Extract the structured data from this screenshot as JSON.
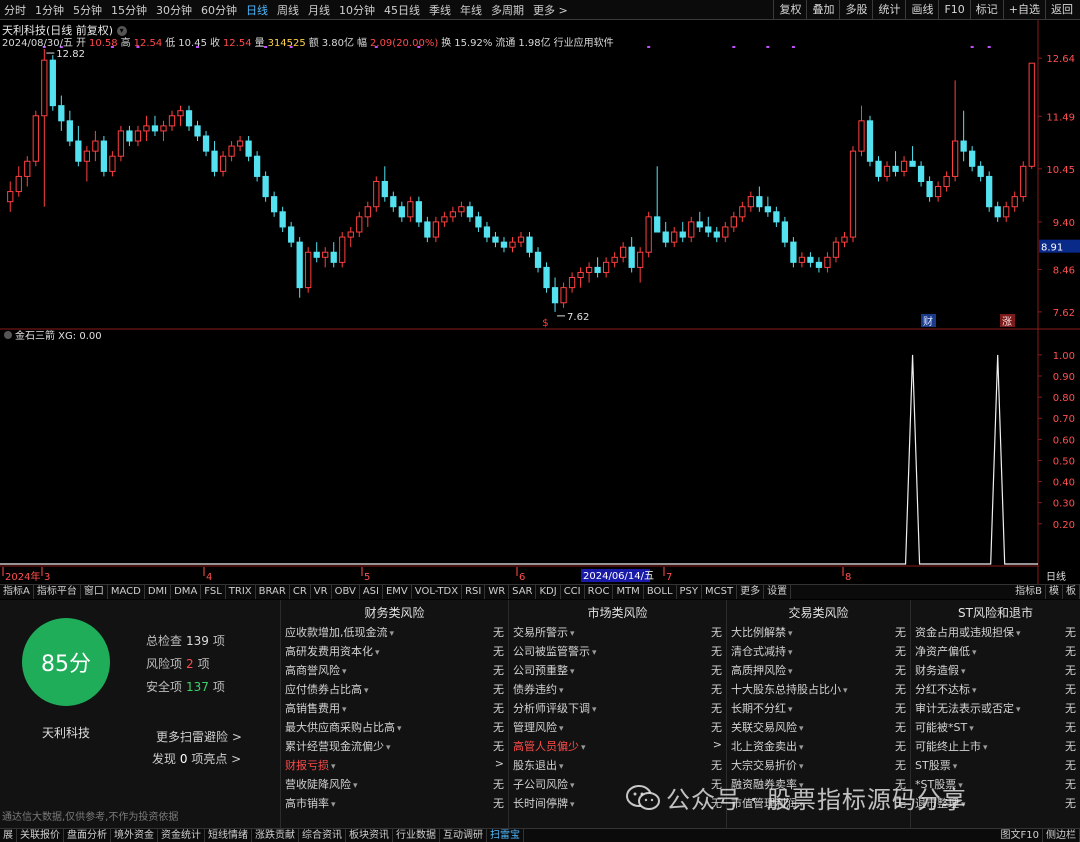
{
  "toolbar": {
    "periods": [
      "分时",
      "1分钟",
      "5分钟",
      "15分钟",
      "30分钟",
      "60分钟",
      "日线",
      "周线",
      "月线",
      "10分钟",
      "45日线",
      "季线",
      "年线",
      "多周期",
      "更多 >"
    ],
    "active_period": "日线",
    "right_buttons": [
      "复权",
      "叠加",
      "多股",
      "统计",
      "画线",
      "F10",
      "标记",
      "+自选",
      "返回"
    ]
  },
  "stock_header": {
    "title": "天利科技(日线 前复权)",
    "date": "2024/08/30/五",
    "open_label": "开",
    "open": "10.58",
    "high_label": "高",
    "high": "12.54",
    "low_label": "低",
    "low": "10.45",
    "close_label": "收",
    "close": "12.54",
    "vol_label": "量",
    "volume": "314525",
    "amt_label": "额",
    "amount": "3.80亿",
    "chg_label": "幅",
    "change": "2.09(20.00%)",
    "turn_label": "换",
    "turnover": "15.92%",
    "float_label": "流通",
    "float_cap": "1.98亿",
    "industry": "行业应用软件"
  },
  "chart_data": [
    {
      "type": "candlestick",
      "title": "",
      "y_ticks": [
        "12.64",
        "11.49",
        "10.45",
        "9.40",
        "8.46",
        "7.62"
      ],
      "ylim": [
        7.4,
        12.9
      ],
      "current_price_label": "8.91",
      "high_label": "12.82",
      "low_label": "7.62",
      "markers": [
        "$",
        "财",
        "涨"
      ],
      "x_labels": [
        "2024年",
        "3",
        "4",
        "5",
        "6",
        "7",
        "8"
      ],
      "cursor_date": "2024/06/14/五",
      "x_axis_name": "日线",
      "ohlc": [
        [
          9.8,
          10.2,
          9.6,
          10.0
        ],
        [
          10.0,
          10.5,
          9.9,
          10.3
        ],
        [
          10.3,
          10.7,
          10.1,
          10.6
        ],
        [
          10.6,
          11.6,
          10.5,
          11.5
        ],
        [
          11.5,
          12.82,
          9.7,
          12.6
        ],
        [
          12.6,
          12.7,
          11.6,
          11.7
        ],
        [
          11.7,
          11.9,
          11.2,
          11.4
        ],
        [
          11.4,
          11.6,
          10.9,
          11.0
        ],
        [
          11.0,
          11.3,
          10.5,
          10.6
        ],
        [
          10.6,
          10.9,
          10.2,
          10.8
        ],
        [
          10.8,
          11.2,
          10.6,
          11.0
        ],
        [
          11.0,
          11.1,
          10.3,
          10.4
        ],
        [
          10.4,
          10.8,
          10.3,
          10.7
        ],
        [
          10.7,
          11.3,
          10.6,
          11.2
        ],
        [
          11.2,
          11.3,
          10.9,
          11.0
        ],
        [
          11.0,
          11.3,
          10.9,
          11.2
        ],
        [
          11.2,
          11.5,
          11.0,
          11.3
        ],
        [
          11.3,
          11.5,
          11.1,
          11.2
        ],
        [
          11.2,
          11.4,
          11.0,
          11.3
        ],
        [
          11.3,
          11.6,
          11.2,
          11.5
        ],
        [
          11.5,
          11.7,
          11.3,
          11.6
        ],
        [
          11.6,
          11.7,
          11.2,
          11.3
        ],
        [
          11.3,
          11.4,
          11.0,
          11.1
        ],
        [
          11.1,
          11.2,
          10.7,
          10.8
        ],
        [
          10.8,
          11.0,
          10.3,
          10.4
        ],
        [
          10.4,
          10.8,
          10.3,
          10.7
        ],
        [
          10.7,
          11.0,
          10.6,
          10.9
        ],
        [
          10.9,
          11.1,
          10.8,
          11.0
        ],
        [
          11.0,
          11.1,
          10.6,
          10.7
        ],
        [
          10.7,
          10.8,
          10.2,
          10.3
        ],
        [
          10.3,
          10.4,
          9.8,
          9.9
        ],
        [
          9.9,
          10.0,
          9.5,
          9.6
        ],
        [
          9.6,
          9.7,
          9.2,
          9.3
        ],
        [
          9.3,
          9.4,
          8.9,
          9.0
        ],
        [
          9.0,
          9.1,
          7.9,
          8.1
        ],
        [
          8.1,
          8.9,
          8.0,
          8.8
        ],
        [
          8.8,
          9.0,
          8.6,
          8.7
        ],
        [
          8.7,
          8.9,
          8.5,
          8.8
        ],
        [
          8.8,
          9.0,
          8.5,
          8.6
        ],
        [
          8.6,
          9.2,
          8.5,
          9.1
        ],
        [
          9.1,
          9.3,
          8.9,
          9.2
        ],
        [
          9.2,
          9.6,
          9.1,
          9.5
        ],
        [
          9.5,
          9.8,
          9.3,
          9.7
        ],
        [
          9.7,
          10.3,
          9.6,
          10.2
        ],
        [
          10.2,
          10.5,
          9.8,
          9.9
        ],
        [
          9.9,
          10.0,
          9.6,
          9.7
        ],
        [
          9.7,
          9.8,
          9.4,
          9.5
        ],
        [
          9.5,
          9.9,
          9.4,
          9.8
        ],
        [
          9.8,
          9.9,
          9.3,
          9.4
        ],
        [
          9.4,
          9.5,
          9.0,
          9.1
        ],
        [
          9.1,
          9.5,
          9.0,
          9.4
        ],
        [
          9.4,
          9.6,
          9.3,
          9.5
        ],
        [
          9.5,
          9.7,
          9.4,
          9.6
        ],
        [
          9.6,
          9.8,
          9.5,
          9.7
        ],
        [
          9.7,
          9.8,
          9.4,
          9.5
        ],
        [
          9.5,
          9.6,
          9.2,
          9.3
        ],
        [
          9.3,
          9.4,
          9.0,
          9.1
        ],
        [
          9.1,
          9.2,
          8.9,
          9.0
        ],
        [
          9.0,
          9.1,
          8.8,
          8.9
        ],
        [
          8.9,
          9.1,
          8.8,
          9.0
        ],
        [
          9.0,
          9.2,
          8.9,
          9.1
        ],
        [
          9.1,
          9.2,
          8.7,
          8.8
        ],
        [
          8.8,
          8.9,
          8.4,
          8.5
        ],
        [
          8.5,
          8.6,
          8.0,
          8.1
        ],
        [
          8.1,
          8.3,
          7.62,
          7.8
        ],
        [
          7.8,
          8.2,
          7.7,
          8.1
        ],
        [
          8.1,
          8.4,
          8.0,
          8.3
        ],
        [
          8.3,
          8.5,
          8.1,
          8.4
        ],
        [
          8.4,
          8.6,
          8.2,
          8.5
        ],
        [
          8.5,
          8.7,
          8.3,
          8.4
        ],
        [
          8.4,
          8.7,
          8.3,
          8.6
        ],
        [
          8.6,
          8.8,
          8.5,
          8.7
        ],
        [
          8.7,
          9.0,
          8.6,
          8.9
        ],
        [
          8.9,
          9.1,
          8.4,
          8.5
        ],
        [
          8.5,
          8.9,
          8.2,
          8.8
        ],
        [
          8.8,
          9.6,
          8.7,
          9.5
        ],
        [
          9.5,
          10.5,
          9.4,
          9.2
        ],
        [
          9.2,
          9.4,
          8.9,
          9.0
        ],
        [
          9.0,
          9.3,
          8.9,
          9.2
        ],
        [
          9.2,
          9.4,
          9.0,
          9.1
        ],
        [
          9.1,
          9.5,
          9.0,
          9.4
        ],
        [
          9.4,
          9.6,
          9.2,
          9.3
        ],
        [
          9.3,
          9.5,
          9.1,
          9.2
        ],
        [
          9.2,
          9.3,
          9.0,
          9.1
        ],
        [
          9.1,
          9.4,
          9.0,
          9.3
        ],
        [
          9.3,
          9.6,
          9.2,
          9.5
        ],
        [
          9.5,
          9.8,
          9.4,
          9.7
        ],
        [
          9.7,
          10.0,
          9.6,
          9.9
        ],
        [
          9.9,
          10.1,
          9.6,
          9.7
        ],
        [
          9.7,
          9.9,
          9.5,
          9.6
        ],
        [
          9.6,
          9.7,
          9.3,
          9.4
        ],
        [
          9.4,
          9.5,
          8.9,
          9.0
        ],
        [
          9.0,
          9.1,
          8.5,
          8.6
        ],
        [
          8.6,
          8.8,
          8.5,
          8.7
        ],
        [
          8.7,
          8.8,
          8.5,
          8.6
        ],
        [
          8.6,
          8.7,
          8.4,
          8.5
        ],
        [
          8.5,
          8.8,
          8.4,
          8.7
        ],
        [
          8.7,
          9.1,
          8.6,
          9.0
        ],
        [
          9.0,
          9.2,
          8.9,
          9.1
        ],
        [
          9.1,
          10.9,
          9.0,
          10.8
        ],
        [
          10.8,
          11.7,
          10.7,
          11.4
        ],
        [
          11.4,
          11.5,
          10.5,
          10.6
        ],
        [
          10.6,
          10.7,
          10.2,
          10.3
        ],
        [
          10.3,
          10.6,
          10.2,
          10.5
        ],
        [
          10.5,
          10.8,
          10.3,
          10.4
        ],
        [
          10.4,
          10.7,
          10.3,
          10.6
        ],
        [
          10.6,
          10.9,
          10.5,
          10.5
        ],
        [
          10.5,
          10.6,
          10.1,
          10.2
        ],
        [
          10.2,
          10.3,
          9.8,
          9.9
        ],
        [
          9.9,
          10.2,
          9.8,
          10.1
        ],
        [
          10.1,
          10.4,
          10.0,
          10.3
        ],
        [
          10.3,
          12.2,
          10.2,
          11.0
        ],
        [
          11.0,
          11.6,
          10.6,
          10.8
        ],
        [
          10.8,
          10.9,
          10.4,
          10.5
        ],
        [
          10.5,
          10.6,
          10.2,
          10.3
        ],
        [
          10.3,
          10.4,
          9.6,
          9.7
        ],
        [
          9.7,
          9.8,
          9.4,
          9.5
        ],
        [
          9.5,
          9.8,
          9.4,
          9.7
        ],
        [
          9.7,
          10.0,
          9.6,
          9.9
        ],
        [
          9.9,
          10.6,
          9.8,
          10.5
        ],
        [
          10.5,
          12.54,
          10.45,
          12.54
        ]
      ]
    },
    {
      "type": "line",
      "title": "金石三箭",
      "series": [
        {
          "name": "XG",
          "current": "0.00",
          "spike_indices": [
            106,
            116
          ]
        }
      ],
      "y_ticks": [
        "1.00",
        "0.90",
        "0.80",
        "0.70",
        "0.60",
        "0.50",
        "0.40",
        "0.30",
        "0.20"
      ],
      "ylim": [
        0,
        1.08
      ]
    }
  ],
  "indicator_tabs": [
    "指标A",
    "指标平台",
    "窗口",
    "MACD",
    "DMI",
    "DMA",
    "FSL",
    "TRIX",
    "BRAR",
    "CR",
    "VR",
    "OBV",
    "ASI",
    "EMV",
    "VOL-TDX",
    "RSI",
    "WR",
    "SAR",
    "KDJ",
    "CCI",
    "ROC",
    "MTM",
    "BOLL",
    "PSY",
    "MCST",
    "更多",
    "设置"
  ],
  "indicator_tabs_right": [
    "指标B",
    "模",
    "板"
  ],
  "scan": {
    "score": "85分",
    "total_label": "总检查",
    "total": "139",
    "total_unit": "项",
    "risk_label": "风险项",
    "risk": "2",
    "risk_unit": "项",
    "safe_label": "安全项",
    "safe": "137",
    "safe_unit": "项",
    "company": "天利科技",
    "more_link": "更多扫雷避险 >",
    "discover_prefix": "发现",
    "discover_count": "0",
    "discover_suffix": "项亮点 >",
    "disclaimer": "通达信大数据,仅供参考,不作为投资依据"
  },
  "risk_columns": [
    {
      "title": "财务类风险",
      "items": [
        {
          "label": "应收款增加,低现金流",
          "value": "无",
          "hl": false
        },
        {
          "label": "高研发费用资本化",
          "value": "无",
          "hl": false
        },
        {
          "label": "高商誉风险",
          "value": "无",
          "hl": false
        },
        {
          "label": "应付债券占比高",
          "value": "无",
          "hl": false
        },
        {
          "label": "高销售费用",
          "value": "无",
          "hl": false
        },
        {
          "label": "最大供应商采购占比高",
          "value": "无",
          "hl": false
        },
        {
          "label": "累计经营现金流偏少",
          "value": "无",
          "hl": false
        },
        {
          "label": "财报亏损",
          "value": ">",
          "hl": true
        },
        {
          "label": "营收陡降风险",
          "value": "无",
          "hl": false
        },
        {
          "label": "高市销率",
          "value": "无",
          "hl": false
        }
      ]
    },
    {
      "title": "市场类风险",
      "items": [
        {
          "label": "交易所警示",
          "value": "无",
          "hl": false
        },
        {
          "label": "公司被监管警示",
          "value": "无",
          "hl": false
        },
        {
          "label": "公司预重整",
          "value": "无",
          "hl": false
        },
        {
          "label": "债券违约",
          "value": "无",
          "hl": false
        },
        {
          "label": "分析师评级下调",
          "value": "无",
          "hl": false
        },
        {
          "label": "管理风险",
          "value": "无",
          "hl": false
        },
        {
          "label": "高管人员偏少",
          "value": ">",
          "hl": true
        },
        {
          "label": "股东退出",
          "value": "无",
          "hl": false
        },
        {
          "label": "子公司风险",
          "value": "无",
          "hl": false
        },
        {
          "label": "长时间停牌",
          "value": "无",
          "hl": false
        }
      ]
    },
    {
      "title": "交易类风险",
      "items": [
        {
          "label": "大比例解禁",
          "value": "无",
          "hl": false
        },
        {
          "label": "清仓式减持",
          "value": "无",
          "hl": false
        },
        {
          "label": "高质押风险",
          "value": "无",
          "hl": false
        },
        {
          "label": "十大股东总持股占比小",
          "value": "无",
          "hl": false
        },
        {
          "label": "长期不分红",
          "value": "无",
          "hl": false
        },
        {
          "label": "关联交易风险",
          "value": "无",
          "hl": false
        },
        {
          "label": "北上资金卖出",
          "value": "无",
          "hl": false
        },
        {
          "label": "大宗交易折价",
          "value": "无",
          "hl": false
        },
        {
          "label": "融资融券卖率",
          "value": "无",
          "hl": false
        },
        {
          "label": "市值管理利润",
          "value": "无",
          "hl": false
        }
      ]
    },
    {
      "title": "ST风险和退市",
      "items": [
        {
          "label": "资金占用或违规担保",
          "value": "无",
          "hl": false
        },
        {
          "label": "净资产偏低",
          "value": "无",
          "hl": false
        },
        {
          "label": "财务造假",
          "value": "无",
          "hl": false
        },
        {
          "label": "分红不达标",
          "value": "无",
          "hl": false
        },
        {
          "label": "审计无法表示或否定",
          "value": "无",
          "hl": false
        },
        {
          "label": "可能被*ST",
          "value": "无",
          "hl": false
        },
        {
          "label": "可能终止上市",
          "value": "无",
          "hl": false
        },
        {
          "label": "ST股票",
          "value": "无",
          "hl": false
        },
        {
          "label": "*ST股票",
          "value": "无",
          "hl": false
        },
        {
          "label": "退市整理",
          "value": "无",
          "hl": false
        }
      ]
    }
  ],
  "statusbar": {
    "items": [
      "展",
      "关联报价",
      "盘面分析",
      "境外资金",
      "资金统计",
      "短线情绪",
      "涨跌贡献",
      "综合资讯",
      "板块资讯",
      "行业数据",
      "互动调研",
      "扫雷宝"
    ],
    "active": "扫雷宝",
    "right": [
      "图文F10",
      "侧边栏"
    ]
  },
  "watermark": {
    "text": "公众号 · 股票指标源码分享"
  },
  "colors": {
    "up": "#ff4040",
    "down": "#54e2f0",
    "score_green": "#1fad5a",
    "highlight_red": "#ff4a4a",
    "accent_blue": "#4fb8ff"
  }
}
